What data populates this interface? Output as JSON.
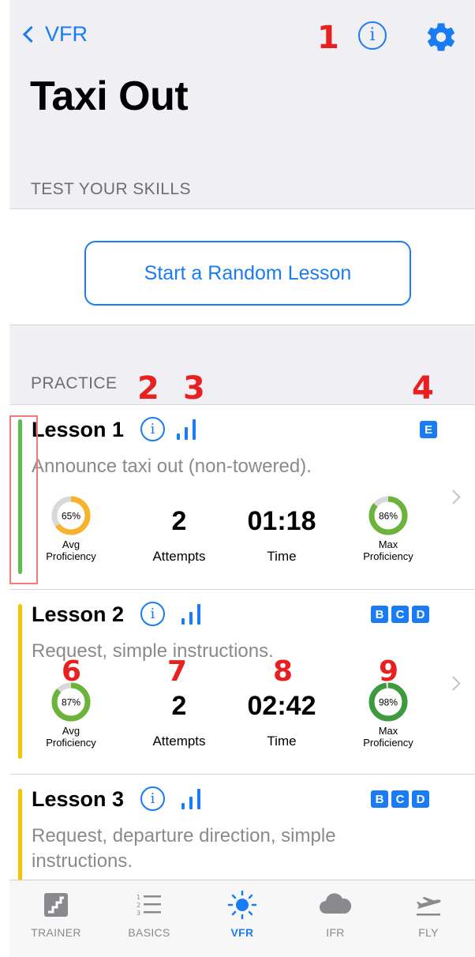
{
  "nav": {
    "back_label": "VFR",
    "title": "Taxi Out"
  },
  "sections": {
    "test": "TEST YOUR SKILLS",
    "practice": "PRACTICE"
  },
  "random_button": "Start a Random Lesson",
  "annotations": [
    "1",
    "2",
    "3",
    "4",
    "6",
    "7",
    "8",
    "9"
  ],
  "lessons": [
    {
      "name": "Lesson 1",
      "description": "Announce taxi out (non-towered).",
      "badges": [
        "E"
      ],
      "bar_color": "#5cbd52",
      "avg": {
        "value": "65%",
        "fraction": 0.65,
        "color": "#f6b32b",
        "label": "Avg\nProficiency"
      },
      "attempts": {
        "value": "2",
        "label": "Attempts"
      },
      "time": {
        "value": "01:18",
        "label": "Time"
      },
      "max": {
        "value": "86%",
        "fraction": 0.86,
        "color": "#6bb33a",
        "label": "Max\nProficiency"
      }
    },
    {
      "name": "Lesson 2",
      "description": "Request, simple instructions.",
      "badges": [
        "B",
        "C",
        "D"
      ],
      "bar_color": "#f6c300",
      "avg": {
        "value": "87%",
        "fraction": 0.87,
        "color": "#6bb33a",
        "label": "Avg\nProficiency"
      },
      "attempts": {
        "value": "2",
        "label": "Attempts"
      },
      "time": {
        "value": "02:42",
        "label": "Time"
      },
      "max": {
        "value": "98%",
        "fraction": 0.98,
        "color": "#3d9a3d",
        "label": "Max\nProficiency"
      }
    },
    {
      "name": "Lesson 3",
      "description": "Request, departure direction, simple instructions.",
      "badges": [
        "B",
        "C",
        "D"
      ],
      "bar_color": "#f6c300"
    }
  ],
  "tabs": [
    {
      "label": "TRAINER",
      "icon": "stairs-icon"
    },
    {
      "label": "BASICS",
      "icon": "list-icon"
    },
    {
      "label": "VFR",
      "icon": "sun-icon",
      "active": true
    },
    {
      "label": "IFR",
      "icon": "cloud-icon"
    },
    {
      "label": "FLY",
      "icon": "plane-takeoff-icon"
    }
  ],
  "colors": {
    "accent": "#1a7cf5",
    "annotation": "#e8201f"
  }
}
